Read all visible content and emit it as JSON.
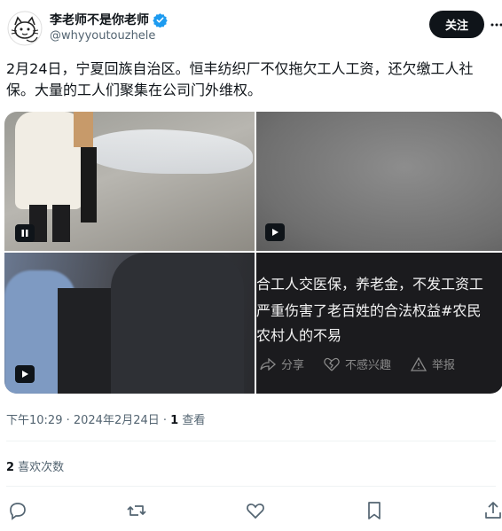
{
  "author": {
    "display_name": "李老师不是你老师",
    "handle": "@whyyoutouzhele",
    "verified": true
  },
  "follow_label": "关注",
  "tweet": {
    "text_line1": "2月24日，宁夏回族自治区。恒丰纺织厂不仅拖欠工人工资，还欠缴工人社",
    "text_line2": "保。大量的工人们聚集在公司门外维权。"
  },
  "media": {
    "video_overlay": {
      "line1": "合工人交医保，养老金，不发工资工",
      "line2": "严重伤害了老百姓的合法权益#农民",
      "line3": "农村人的不易",
      "share": "分享",
      "not_interested": "不感兴趣",
      "report": "举报"
    }
  },
  "meta": {
    "time": "下午10:29 · 2024年2月24日 · ",
    "views_count": "1",
    "views_label": " 查看"
  },
  "stats": {
    "likes_count": "2",
    "likes_label": " 喜欢次数"
  },
  "colors": {
    "text": "#0f1419",
    "secondary": "#536471",
    "verified": "#1d9bf0",
    "follow_bg": "#0f1419"
  }
}
